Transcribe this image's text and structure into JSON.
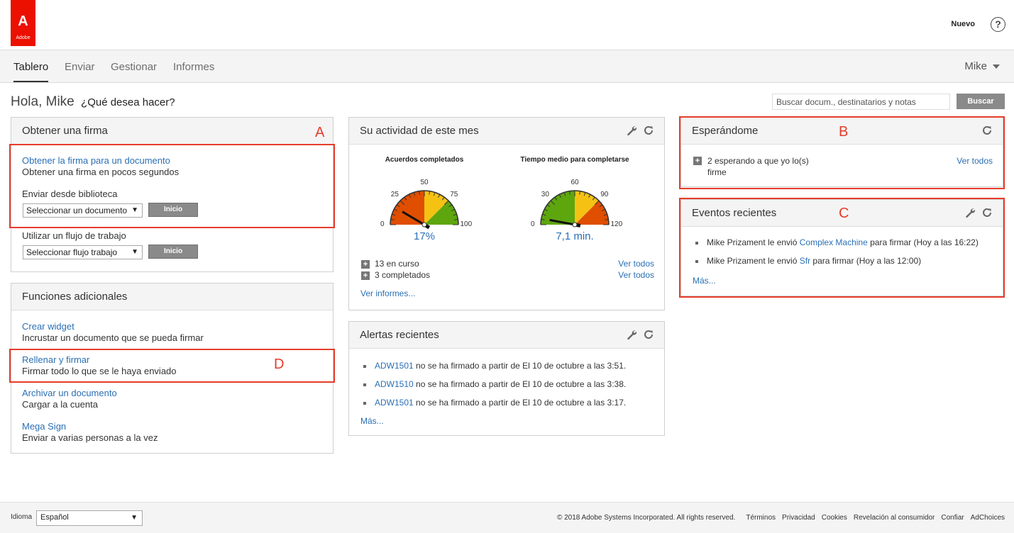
{
  "header": {
    "logo_text": "Adobe",
    "new_label": "Nuevo",
    "help_label": "?"
  },
  "nav": {
    "tabs": [
      {
        "label": "Tablero",
        "active": true
      },
      {
        "label": "Enviar",
        "active": false
      },
      {
        "label": "Gestionar",
        "active": false
      },
      {
        "label": "Informes",
        "active": false
      }
    ],
    "user": "Mike"
  },
  "greeting": {
    "hello": "Hola, Mike",
    "question": "¿Qué desea hacer?"
  },
  "search": {
    "placeholder": "Buscar docum., destinatarios y notas",
    "button": "Buscar"
  },
  "get_signature": {
    "title": "Obtener una firma",
    "link": "Obtener la firma para un documento",
    "desc": "Obtener una firma en pocos segundos",
    "library_label": "Enviar desde biblioteca",
    "library_select": "Seleccionar un documento",
    "start": "Inicio",
    "workflow_label": "Utilizar un flujo de trabajo",
    "workflow_select": "Seleccionar flujo trabajo"
  },
  "additional": {
    "title": "Funciones adicionales",
    "items": [
      {
        "link": "Crear widget",
        "desc": "Incrustar un documento que se pueda firmar"
      },
      {
        "link": "Rellenar y firmar",
        "desc": "Firmar todo lo que se le haya enviado"
      },
      {
        "link": "Archivar un documento",
        "desc": "Cargar a la cuenta"
      },
      {
        "link": "Mega Sign",
        "desc": "Enviar a varias personas a la vez"
      }
    ]
  },
  "activity": {
    "title": "Su actividad de este mes",
    "gauges": [
      {
        "title": "Acuerdos completados",
        "ticks": [
          "0",
          "25",
          "50",
          "75",
          "100"
        ],
        "value_label": "17%",
        "value": 17,
        "min": 0,
        "max": 100
      },
      {
        "title": "Tiempo medio para completarse",
        "ticks": [
          "0",
          "30",
          "60",
          "90",
          "120"
        ],
        "value_label": "7,1 min.",
        "value": 7.1,
        "min": 0,
        "max": 120
      }
    ],
    "rows": [
      {
        "label": "13 en curso",
        "link": "Ver todos"
      },
      {
        "label": "3 completados",
        "link": "Ver todos"
      }
    ],
    "reports_link": "Ver informes..."
  },
  "alerts": {
    "title": "Alertas recientes",
    "items": [
      {
        "id": "ADW1501",
        "text": "no se ha firmado a partir de El 10 de octubre a las 3:51."
      },
      {
        "id": "ADW1510",
        "text": "no se ha firmado a partir de El 10 de octubre a las 3:38."
      },
      {
        "id": "ADW1501",
        "text": "no se ha firmado a partir de El 10 de octubre a las 3:17."
      }
    ],
    "more": "Más..."
  },
  "waiting": {
    "title": "Esperándome",
    "line1": "2 esperando a que yo lo(s)",
    "line2": "firme",
    "link": "Ver todos"
  },
  "events": {
    "title": "Eventos recientes",
    "items": [
      {
        "pre": "Mike Prizament le envió",
        "doc": "Complex Machine",
        "post": "para firmar (Hoy a las 16:22)"
      },
      {
        "pre": "Mike Prizament le envió",
        "doc": "Sfr",
        "post": "para firmar (Hoy a las 12:00)"
      }
    ],
    "more": "Más..."
  },
  "annotations": {
    "a": "A",
    "b": "B",
    "c": "C",
    "d": "D"
  },
  "footer": {
    "language_label": "Idioma",
    "language": "Español",
    "copyright": "© 2018 Adobe Systems Incorporated. All rights reserved.",
    "links": [
      "Términos",
      "Privacidad",
      "Cookies",
      "Revelación al consumidor",
      "Confiar",
      "AdChoices"
    ]
  },
  "colors": {
    "accent": "#2a6fb5",
    "brand": "#eb1000",
    "annotation": "#e63c2b",
    "gauge_red": "#e04e00",
    "gauge_yellow": "#f5c214",
    "gauge_green": "#5ea60e"
  }
}
